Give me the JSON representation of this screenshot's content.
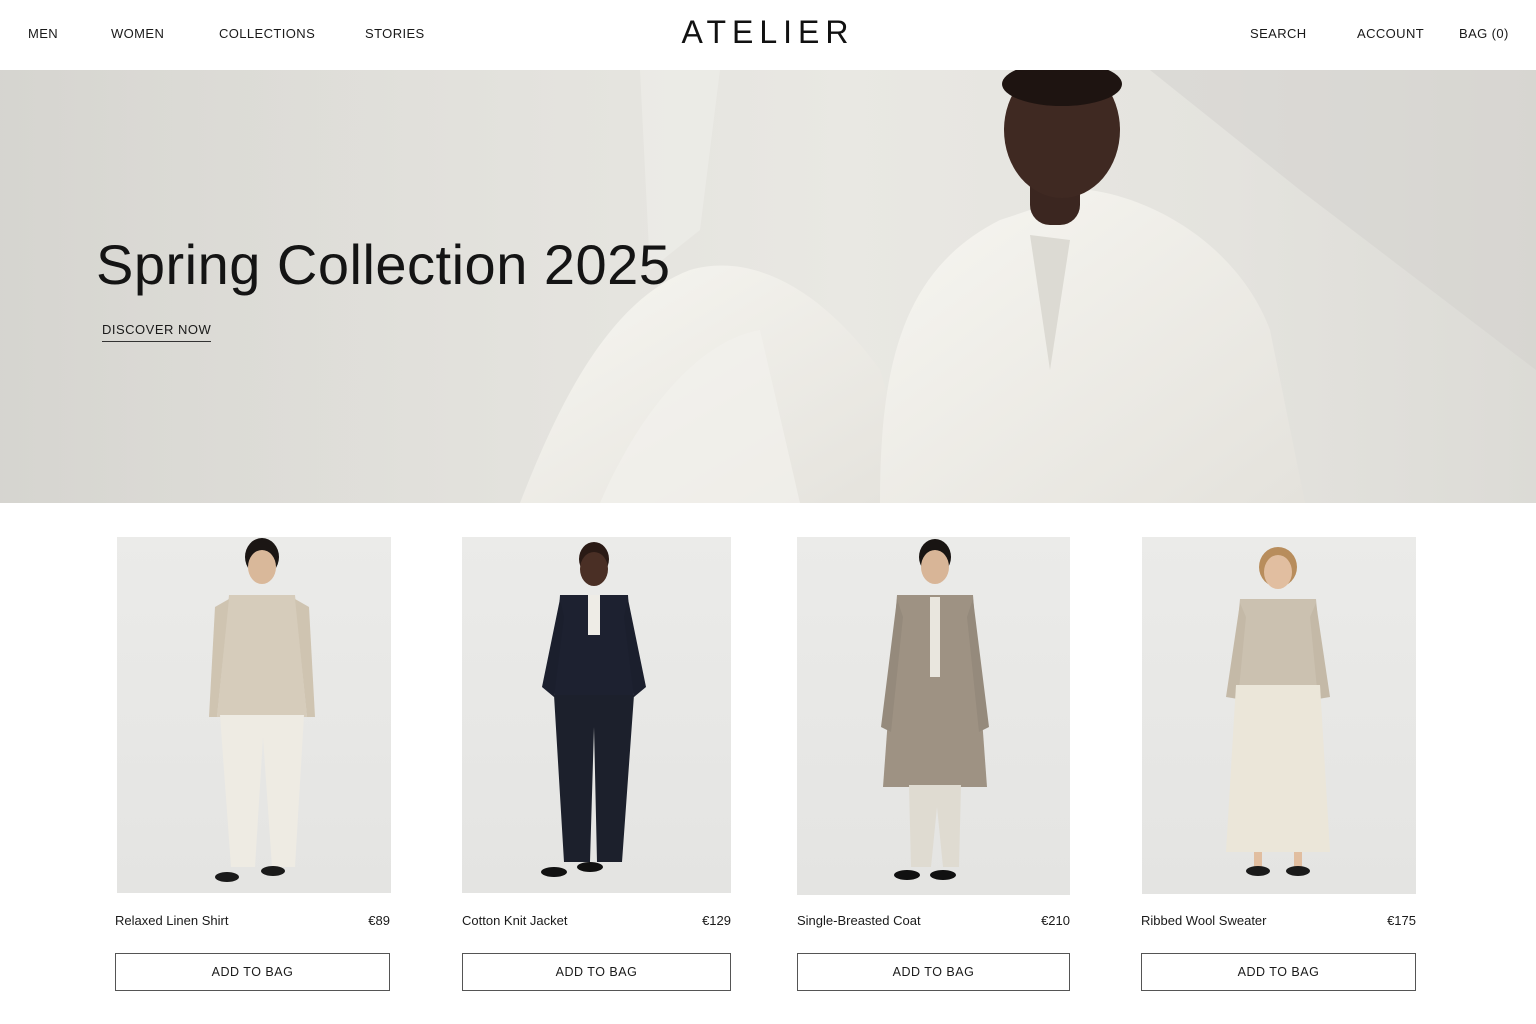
{
  "header": {
    "nav_left": [
      "MEN",
      "WOMEN",
      "COLLECTIONS",
      "STORIES"
    ],
    "logo": "ATELIER",
    "search_label": "SEARCH",
    "account_label": "ACCOUNT",
    "bag_label": "BAG (0)"
  },
  "hero": {
    "title": "Spring Collection 2025",
    "cta_label": "DISCOVER NOW"
  },
  "products": [
    {
      "name": "Relaxed Linen Shirt",
      "price": "€89",
      "button": "ADD TO BAG"
    },
    {
      "name": "Cotton Knit Jacket",
      "price": "€129",
      "button": "ADD TO BAG"
    },
    {
      "name": "Single-Breasted Coat",
      "price": "€210",
      "button": "ADD TO BAG"
    },
    {
      "name": "Ribbed Wool Sweater",
      "price": "€175",
      "button": "ADD TO BAG"
    }
  ],
  "colors": {
    "text": "#111111",
    "background": "#ffffff",
    "hero_background": "#e2e1dc",
    "button_border": "#555555"
  }
}
